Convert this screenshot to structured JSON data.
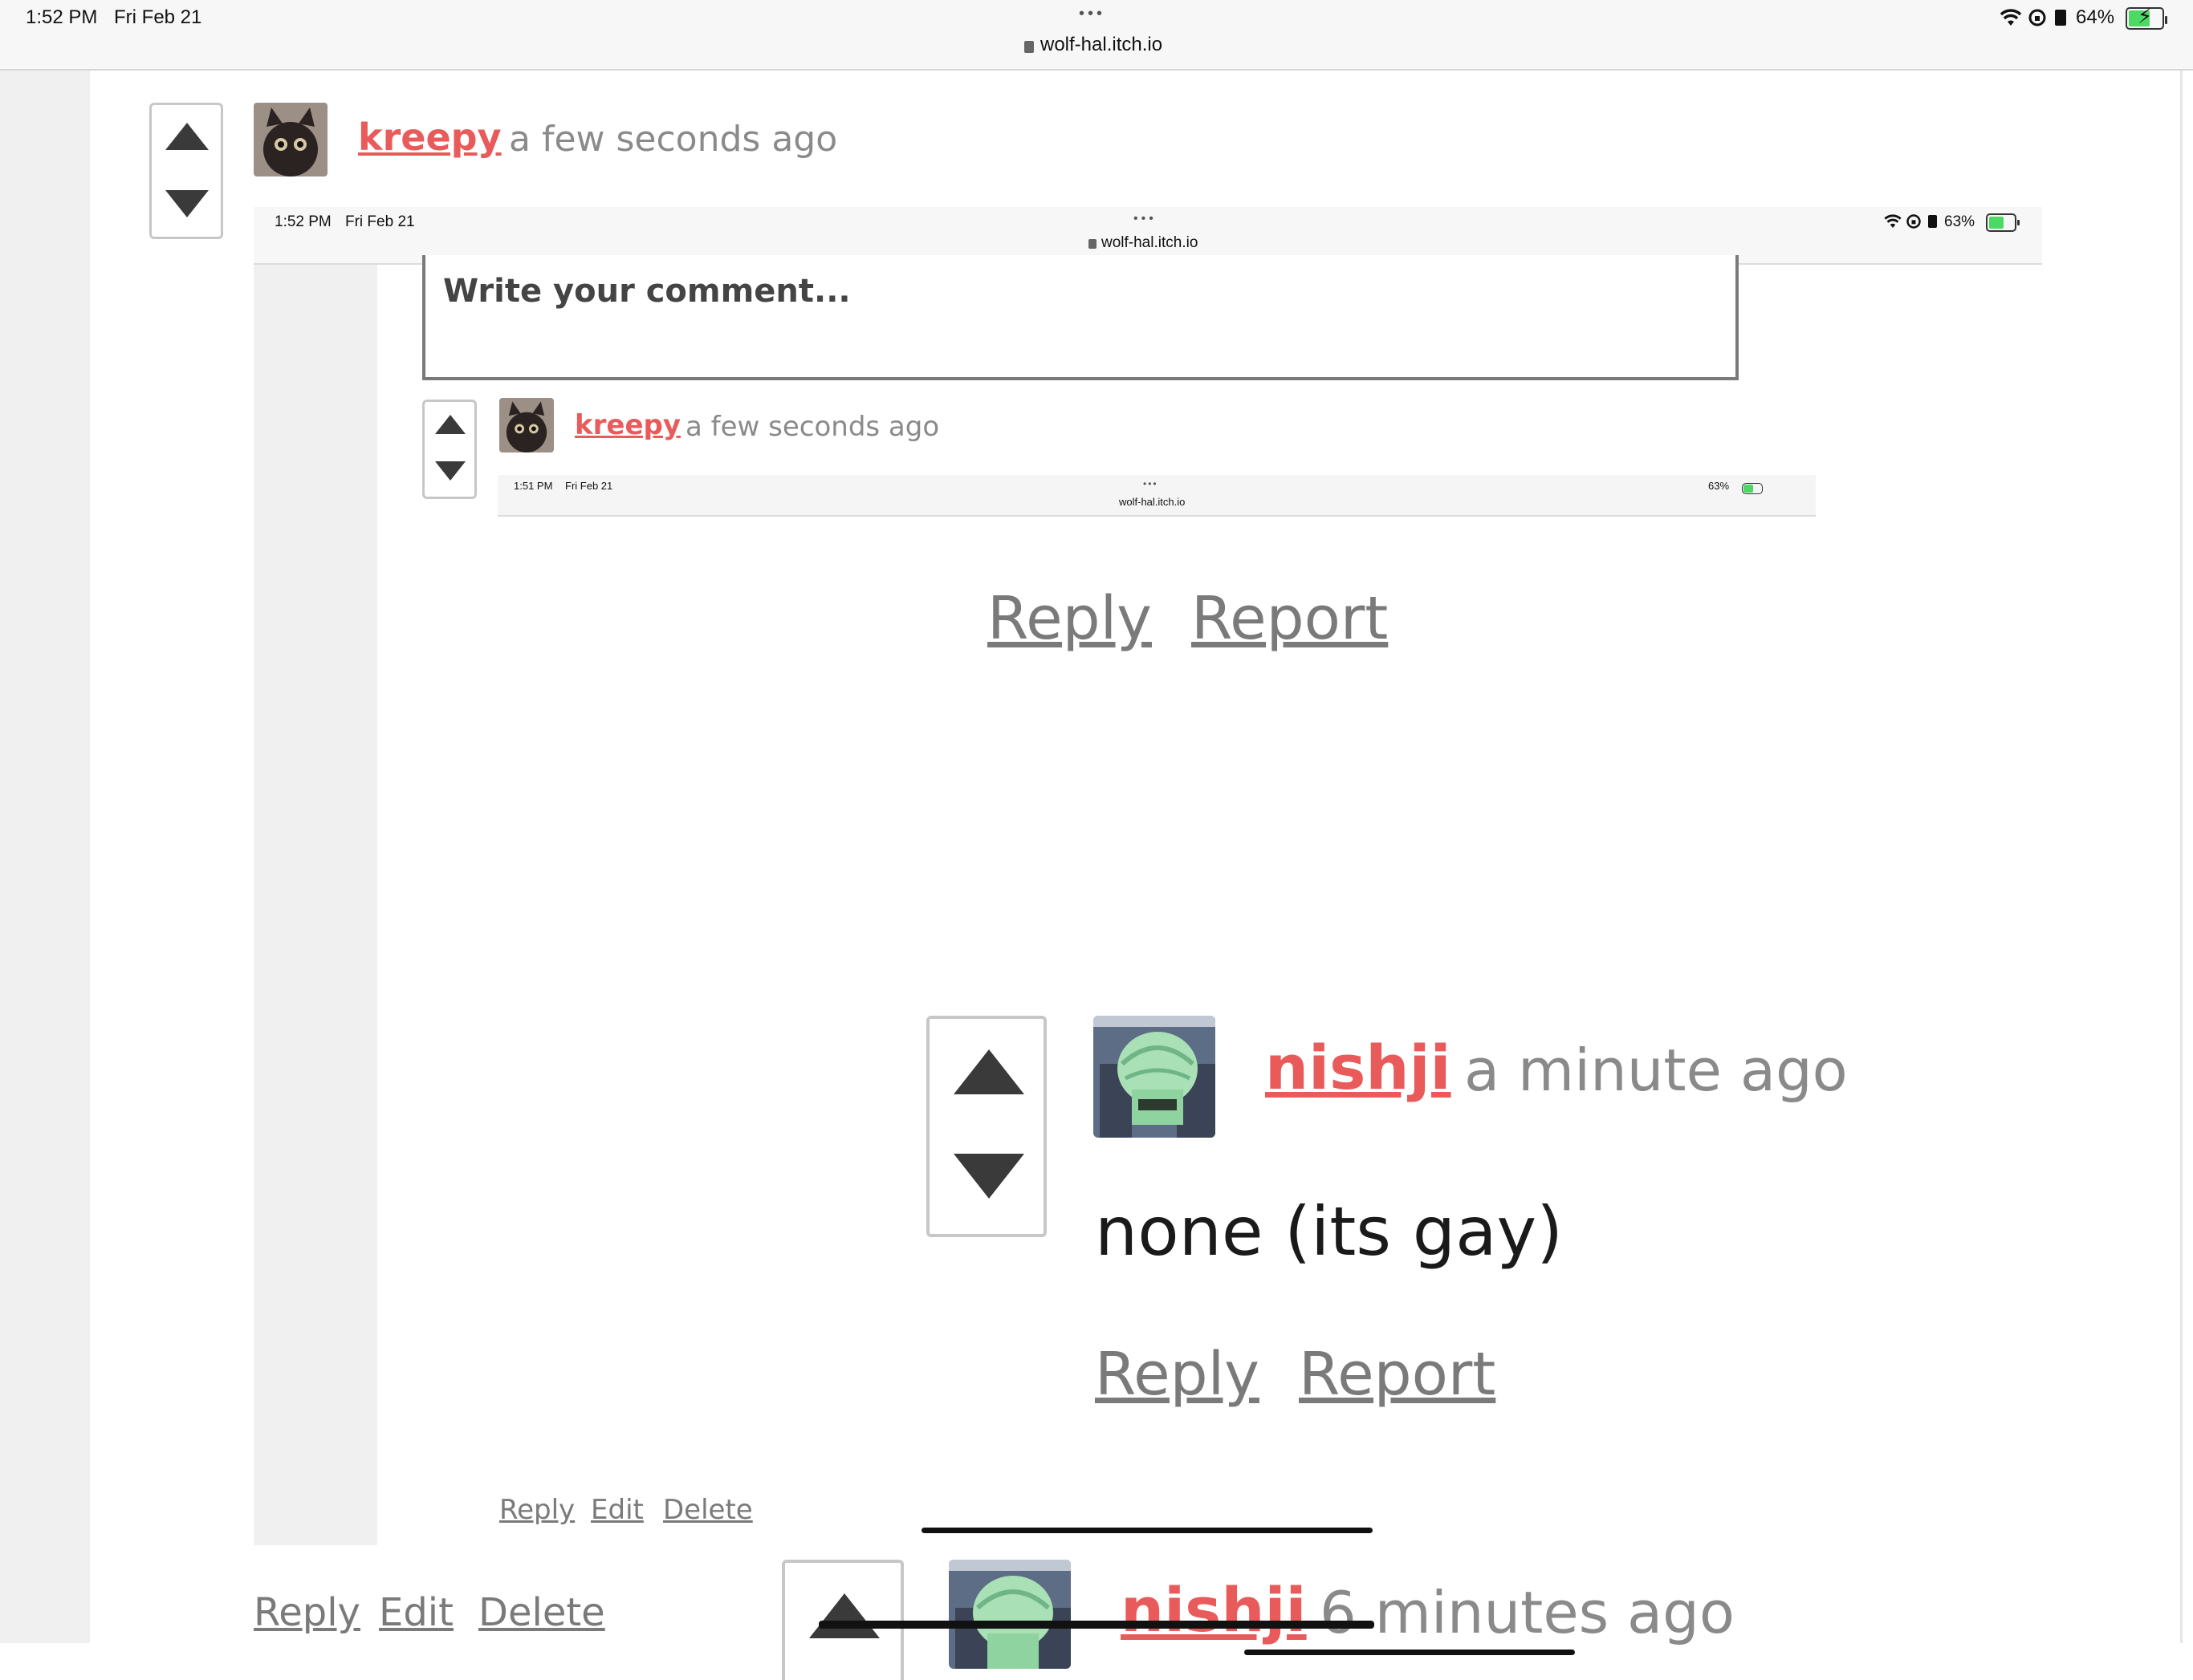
{
  "status_bar": {
    "time": "1:52 PM",
    "date": "Fri Feb 21",
    "dots": "•••",
    "url": "wolf-hal.itch.io",
    "battery": "64%",
    "icons": [
      "wifi-icon",
      "orientation-lock-icon",
      "lock-small-icon",
      "battery-icon"
    ]
  },
  "comment": {
    "username": "kreepy",
    "timestamp": "a few seconds ago",
    "actions": {
      "reply": "Reply",
      "edit": "Edit",
      "delete": "Delete"
    }
  },
  "screenshot1": {
    "status_bar": {
      "time": "1:52 PM",
      "date": "Fri Feb 21",
      "dots": "•••",
      "url": "wolf-hal.itch.io",
      "battery": "63%"
    },
    "comment_input_placeholder": "Write your comment...",
    "comment": {
      "username": "kreepy",
      "timestamp": "a few seconds ago",
      "actions": {
        "reply": "Reply",
        "edit": "Edit",
        "delete": "Delete"
      }
    },
    "screenshot2": {
      "status_bar": {
        "time": "1:51 PM",
        "date": "Fri Feb 21",
        "dots": "•••",
        "url": "wolf-hal.itch.io",
        "battery": "63%"
      },
      "actions": {
        "reply": "Reply",
        "report": "Report"
      },
      "reply_comment": {
        "username": "nishji",
        "timestamp": "a minute ago",
        "body": "none (its gay)",
        "actions": {
          "reply": "Reply",
          "report": "Report"
        }
      },
      "parent_comment": {
        "username": "nishji",
        "timestamp": "6 minutes ago"
      }
    }
  },
  "colors": {
    "username": "#e95b5b",
    "link": "#7a7a7a",
    "battery_fill": "#4cd964"
  }
}
